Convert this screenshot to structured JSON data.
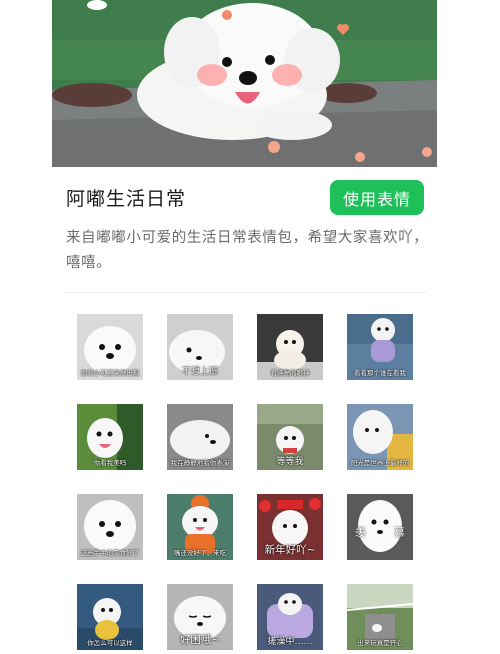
{
  "pack": {
    "title": "阿嘟生活日常",
    "use_button": "使用表情",
    "description": "来自嘟嘟小可爱的生活日常表情包，希望大家喜欢吖，嘻嘻。"
  },
  "stickers": [
    {
      "caption": "你的小可爱突然出现",
      "bg": "#d9d9d9"
    },
    {
      "caption": "不想上班",
      "bg": "#cfcfcf"
    },
    {
      "caption": "看漂亮的眼神",
      "bg": "#3a3a3a"
    },
    {
      "caption": "看看那个谁在看我",
      "bg": "#4a6d8c"
    },
    {
      "caption": "你看我美吗",
      "bg": "#5a8c3a"
    },
    {
      "caption": "我在静静地看你表演",
      "bg": "#8a8a8a"
    },
    {
      "caption": "等等我",
      "bg": "#7a8a6a"
    },
    {
      "caption": "阳光是世界上最好的",
      "bg": "#7a96b4"
    },
    {
      "caption": "这些手中的零食好了",
      "bg": "#bfbfbf"
    },
    {
      "caption": "嘴还没好了，来吃",
      "bg": "#4c7d6a"
    },
    {
      "caption": "新年好吖~",
      "top_caption": "新年好吖",
      "bg": "#7a3030"
    },
    {
      "caption": "",
      "left_text": "羡",
      "right_text": "慕",
      "bg": "#5a5a5a"
    },
    {
      "caption": "你怎么可以这样",
      "bg": "#355a80"
    },
    {
      "caption": "好困哦~",
      "bg": "#b5b5b5"
    },
    {
      "caption": "搓澡中……",
      "bg": "#4a5a7a"
    },
    {
      "caption": "出来玩真是开心",
      "bg": "#6f8f5a"
    }
  ]
}
